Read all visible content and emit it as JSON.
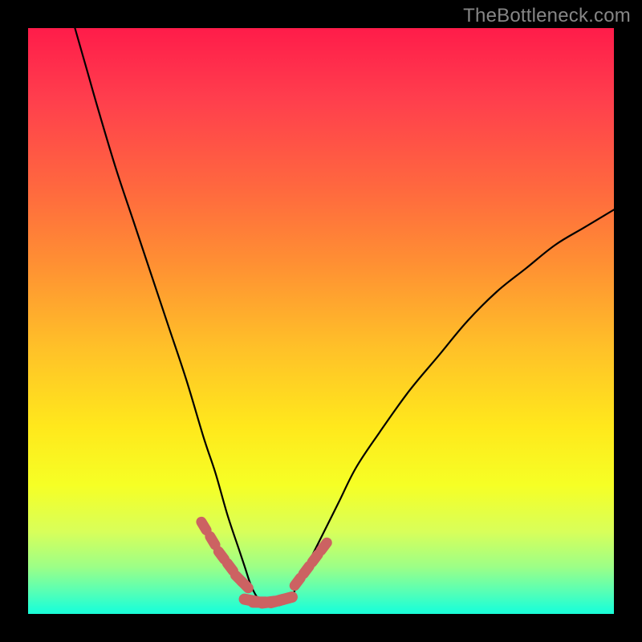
{
  "watermark": {
    "text": "TheBottleneck.com"
  },
  "chart_data": {
    "type": "line",
    "title": "",
    "xlabel": "",
    "ylabel": "",
    "xlim": [
      0,
      100
    ],
    "ylim": [
      0,
      100
    ],
    "grid": false,
    "series": [
      {
        "name": "curve",
        "x": [
          8,
          10,
          12,
          15,
          18,
          21,
          24,
          27,
          30,
          32,
          34,
          36,
          37,
          38,
          39,
          40,
          41,
          42,
          43,
          44,
          45,
          46,
          48,
          50,
          53,
          56,
          60,
          65,
          70,
          75,
          80,
          85,
          90,
          95,
          100
        ],
        "y": [
          100,
          93,
          86,
          76,
          67,
          58,
          49,
          40,
          30,
          24,
          17,
          11,
          8,
          5,
          3,
          2,
          1.5,
          1.5,
          1.5,
          2,
          3,
          5,
          9,
          13,
          19,
          25,
          31,
          38,
          44,
          50,
          55,
          59,
          63,
          66,
          69
        ]
      }
    ],
    "markers": [
      {
        "name": "left-cluster",
        "x": [
          30,
          31.5,
          33,
          34.5,
          36,
          37
        ],
        "y": [
          15,
          12.5,
          10,
          8,
          6,
          5
        ]
      },
      {
        "name": "valley-floor",
        "x": [
          38,
          39.5,
          41,
          42.5,
          44
        ],
        "y": [
          2.3,
          2.0,
          2.0,
          2.2,
          2.6
        ]
      },
      {
        "name": "right-cluster",
        "x": [
          46,
          47.5,
          49,
          50.5
        ],
        "y": [
          5.5,
          7.5,
          9.5,
          11.5
        ]
      }
    ],
    "colors": {
      "curve": "#000000",
      "markers": "#cc6262"
    }
  }
}
